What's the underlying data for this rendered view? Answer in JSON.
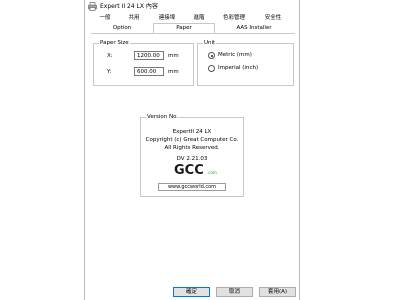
{
  "window": {
    "title": "Expert II 24 LX 內容"
  },
  "tabs_upper": [
    "一般",
    "共用",
    "連接埠",
    "進階",
    "色彩管理",
    "安全性"
  ],
  "tabs_lower": [
    "Option",
    "Paper",
    "AAS Installer"
  ],
  "selected_tab": "Paper",
  "paper_size": {
    "title": "Paper Size",
    "x_label": "X:",
    "x_value": "1200.00",
    "y_label": "Y:",
    "y_value": "600.00",
    "unit_suffix": "mm"
  },
  "unit": {
    "title": "Unit",
    "options": [
      "Metric (mm)",
      "Imperial (inch)"
    ],
    "selected": "Metric (mm)"
  },
  "version": {
    "title": "Version No.",
    "lines": [
      "ExpertII 24 LX",
      "Copyright (c) Great Computer Co.",
      "All Rights Reserved.",
      "DV 2.21.03"
    ],
    "logo_text": "GCC",
    "logo_suffix": ".com",
    "url": "www.gccworld.com"
  },
  "buttons": [
    "確定",
    "取消",
    "套用(A)"
  ],
  "colors": {
    "logo_green": "#2e9e3e",
    "logo_dark": "#1a1a1a",
    "default_button_border": "#0078d7"
  }
}
